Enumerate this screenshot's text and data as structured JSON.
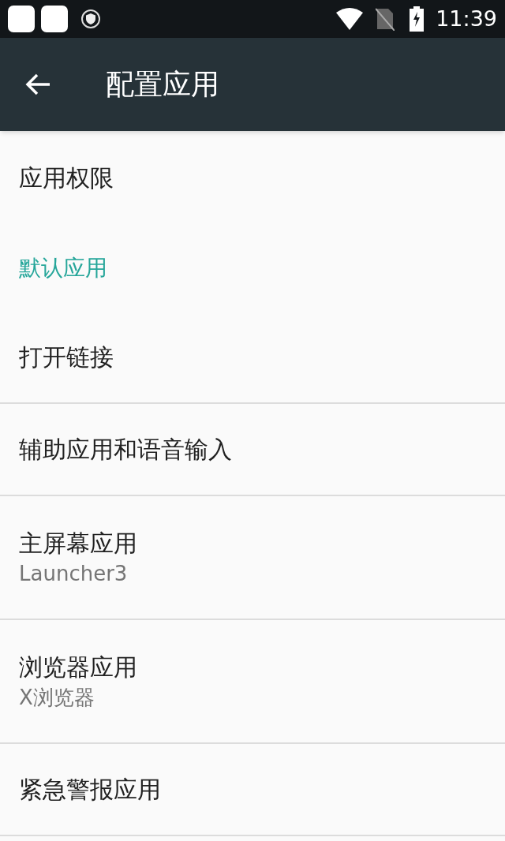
{
  "status_bar": {
    "time": "11:39"
  },
  "app_bar": {
    "title": "配置应用"
  },
  "items": [
    {
      "kind": "item",
      "title": "应用权限",
      "divider": false
    },
    {
      "kind": "header",
      "title": "默认应用"
    },
    {
      "kind": "item",
      "title": "打开链接",
      "divider": true
    },
    {
      "kind": "item",
      "title": "辅助应用和语音输入",
      "divider": true
    },
    {
      "kind": "item",
      "title": "主屏幕应用",
      "subtitle": "Launcher3",
      "divider": true
    },
    {
      "kind": "item",
      "title": "浏览器应用",
      "subtitle": "X浏览器",
      "divider": true
    },
    {
      "kind": "item",
      "title": "紧急警报应用",
      "divider": true
    }
  ]
}
